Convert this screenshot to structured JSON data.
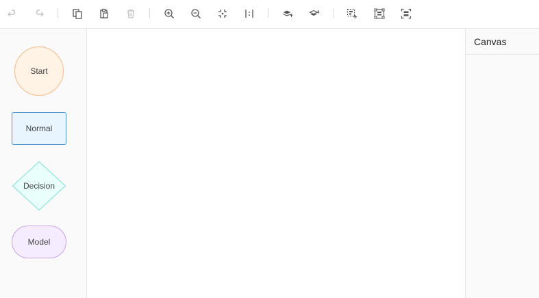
{
  "toolbar": {
    "buttons": [
      {
        "id": "undo",
        "icon": "undo-icon",
        "disabled": true
      },
      {
        "id": "redo",
        "icon": "redo-icon",
        "disabled": true
      },
      {
        "id": "copy",
        "icon": "copy-icon",
        "disabled": false
      },
      {
        "id": "paste",
        "icon": "paste-icon",
        "disabled": false
      },
      {
        "id": "delete",
        "icon": "trash-icon",
        "disabled": true
      },
      {
        "id": "zoom-in",
        "icon": "zoom-in-icon",
        "disabled": false
      },
      {
        "id": "zoom-out",
        "icon": "zoom-out-icon",
        "disabled": false
      },
      {
        "id": "fit-view",
        "icon": "fit-view-icon",
        "disabled": false
      },
      {
        "id": "actual-size",
        "icon": "actual-size-icon",
        "disabled": false
      },
      {
        "id": "to-front",
        "icon": "bring-to-front-icon",
        "disabled": false
      },
      {
        "id": "to-back",
        "icon": "send-to-back-icon",
        "disabled": false
      },
      {
        "id": "multi-select",
        "icon": "multi-select-icon",
        "disabled": false
      },
      {
        "id": "group",
        "icon": "group-icon",
        "disabled": false
      },
      {
        "id": "ungroup",
        "icon": "ungroup-icon",
        "disabled": false
      }
    ]
  },
  "palette": {
    "start": "Start",
    "normal": "Normal",
    "decision": "Decision",
    "model": "Model"
  },
  "detail_panel": {
    "title": "Canvas"
  },
  "colors": {
    "start_fill": "#fff3e6",
    "start_stroke": "#f7b98a",
    "normal_fill": "#e8f5ff",
    "normal_stroke": "#4a90d9",
    "decision_fill": "#e8fffb",
    "decision_stroke": "#7fe0d3",
    "model_fill": "#f6ecff",
    "model_stroke": "#c8a2e6"
  }
}
